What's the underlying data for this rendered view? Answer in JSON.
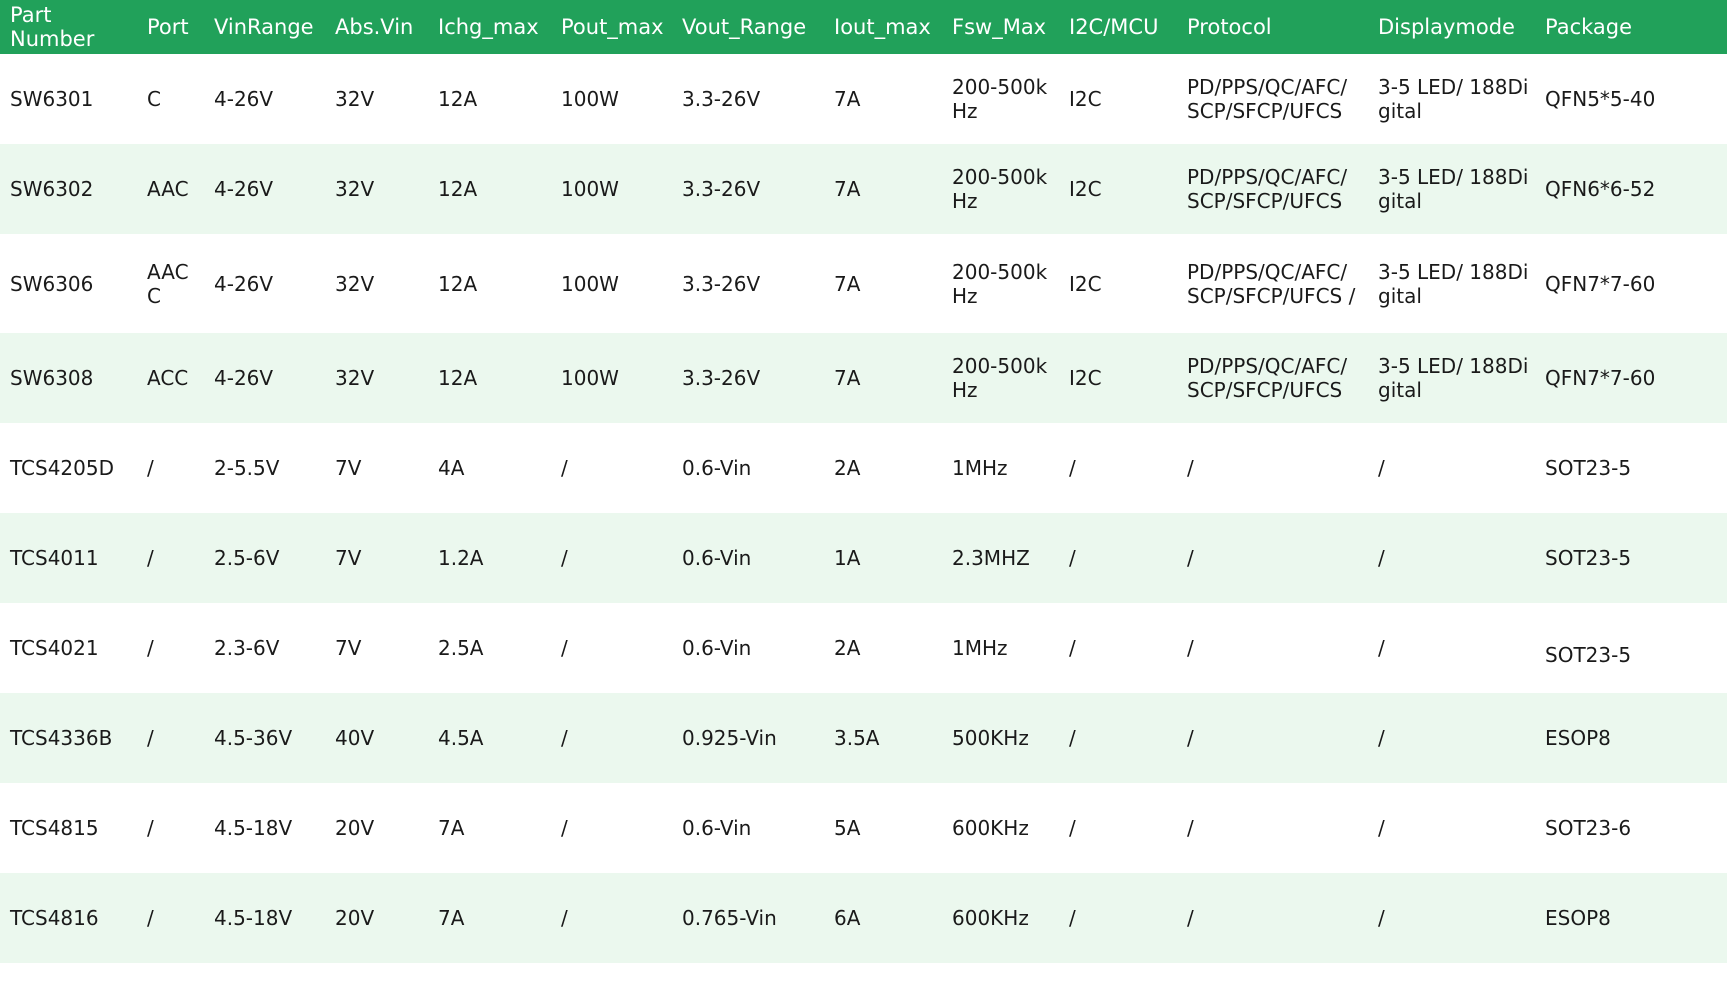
{
  "table": {
    "header_color": "#21a15a",
    "stripe_color": "#ebf8ee",
    "columns": [
      "Part Number",
      "Port",
      "VinRange",
      "Abs.Vin",
      "Ichg_max",
      "Pout_max",
      "Vout_Range",
      "Iout_max",
      "Fsw_Max",
      "I2C/MCU",
      "Protocol",
      "Displaymode",
      "Package"
    ],
    "rows": [
      [
        "SW6301",
        "C",
        "4-26V",
        "32V",
        "12A",
        "100W",
        "3.3-26V",
        "7A",
        "200-500kHz",
        "I2C",
        "PD/PPS/QC/AFC/ SCP/SFCP/UFCS",
        "3-5 LED/ 188Digital",
        "QFN5*5-40"
      ],
      [
        "SW6302",
        "AAC",
        "4-26V",
        "32V",
        "12A",
        "100W",
        "3.3-26V",
        "7A",
        "200-500kHz",
        "I2C",
        "PD/PPS/QC/AFC/ SCP/SFCP/UFCS",
        "3-5 LED/ 188Digital",
        "QFN6*6-52"
      ],
      [
        "SW6306",
        "AAC C",
        "4-26V",
        "32V",
        "12A",
        "100W",
        "3.3-26V",
        "7A",
        "200-500kHz",
        "I2C",
        "PD/PPS/QC/AFC/ SCP/SFCP/UFCS /",
        "3-5 LED/ 188Digital",
        "QFN7*7-60"
      ],
      [
        "SW6308",
        "ACC",
        "4-26V",
        "32V",
        "12A",
        "100W",
        "3.3-26V",
        "7A",
        "200-500kHz",
        "I2C",
        "PD/PPS/QC/AFC/ SCP/SFCP/UFCS",
        "3-5 LED/ 188Digital",
        "QFN7*7-60"
      ],
      [
        "TCS4205D",
        "/",
        "2-5.5V",
        "7V",
        "4A",
        "/",
        "0.6-Vin",
        "2A",
        "1MHz",
        "/",
        "/",
        "/",
        "SOT23-5"
      ],
      [
        "TCS4011",
        "/",
        "2.5-6V",
        "7V",
        "1.2A",
        "/",
        "0.6-Vin",
        "1A",
        "2.3MHZ",
        "/",
        "/",
        "/",
        "SOT23-5"
      ],
      [
        "TCS4021",
        "/",
        "2.3-6V",
        "7V",
        "2.5A",
        "/",
        "0.6-Vin",
        "2A",
        "1MHz",
        "/",
        "/",
        "/",
        "SOT23-5"
      ],
      [
        "TCS4336B",
        "/",
        "4.5-36V",
        "40V",
        "4.5A",
        "/",
        "0.925-Vin",
        "3.5A",
        "500KHz",
        "/",
        "/",
        "/",
        "ESOP8"
      ],
      [
        "TCS4815",
        "/",
        "4.5-18V",
        "20V",
        "7A",
        "/",
        "0.6-Vin",
        "5A",
        "600KHz",
        "/",
        "/",
        "/",
        "SOT23-6"
      ],
      [
        "TCS4816",
        "/",
        "4.5-18V",
        "20V",
        "7A",
        "/",
        "0.765-Vin",
        "6A",
        "600KHz",
        "/",
        "/",
        "/",
        "ESOP8"
      ]
    ]
  }
}
